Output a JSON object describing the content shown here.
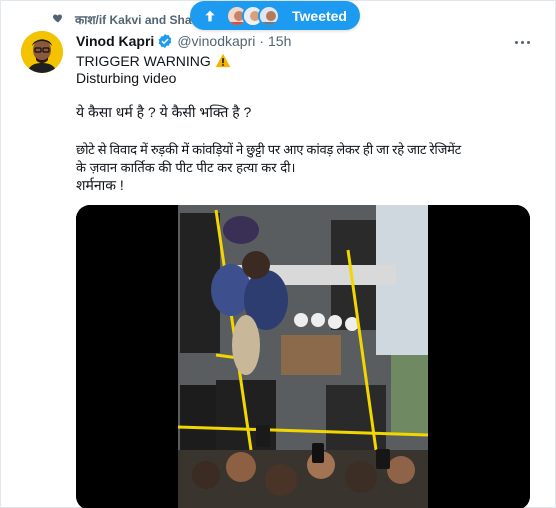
{
  "context": {
    "label": "काश/if Kakvi and Sha"
  },
  "tweeted_pill": {
    "label": "Tweeted"
  },
  "author": {
    "display_name": "Vinod Kapri",
    "handle": "@vinodkapri",
    "separator": "·",
    "time": "15h"
  },
  "tweet": {
    "line1": "TRIGGER WARNING",
    "line2": "Disturbing video",
    "line3": "ये कैसा धर्म है ? ये कैसी भक्ति है ?",
    "line4": "छोटे से विवाद में रुड़की में कांवड़ियों ने छुट्टी पर आए कांवड़ लेकर ही  जा रहे जाट रेजिमेंट",
    "line5": "के ज़वान कार्तिक की पीट पीट कर हत्या कर दी।",
    "line6": "शर्मनाक !"
  },
  "icons": {
    "heart": "heart-icon",
    "up_arrow": "arrow-up-icon",
    "verified": "verified-badge-icon",
    "warning": "warning-icon",
    "more": "more-icon"
  },
  "colors": {
    "accent": "#1d9bf0",
    "secondary_text": "#536471",
    "warning": "#f5b400"
  }
}
